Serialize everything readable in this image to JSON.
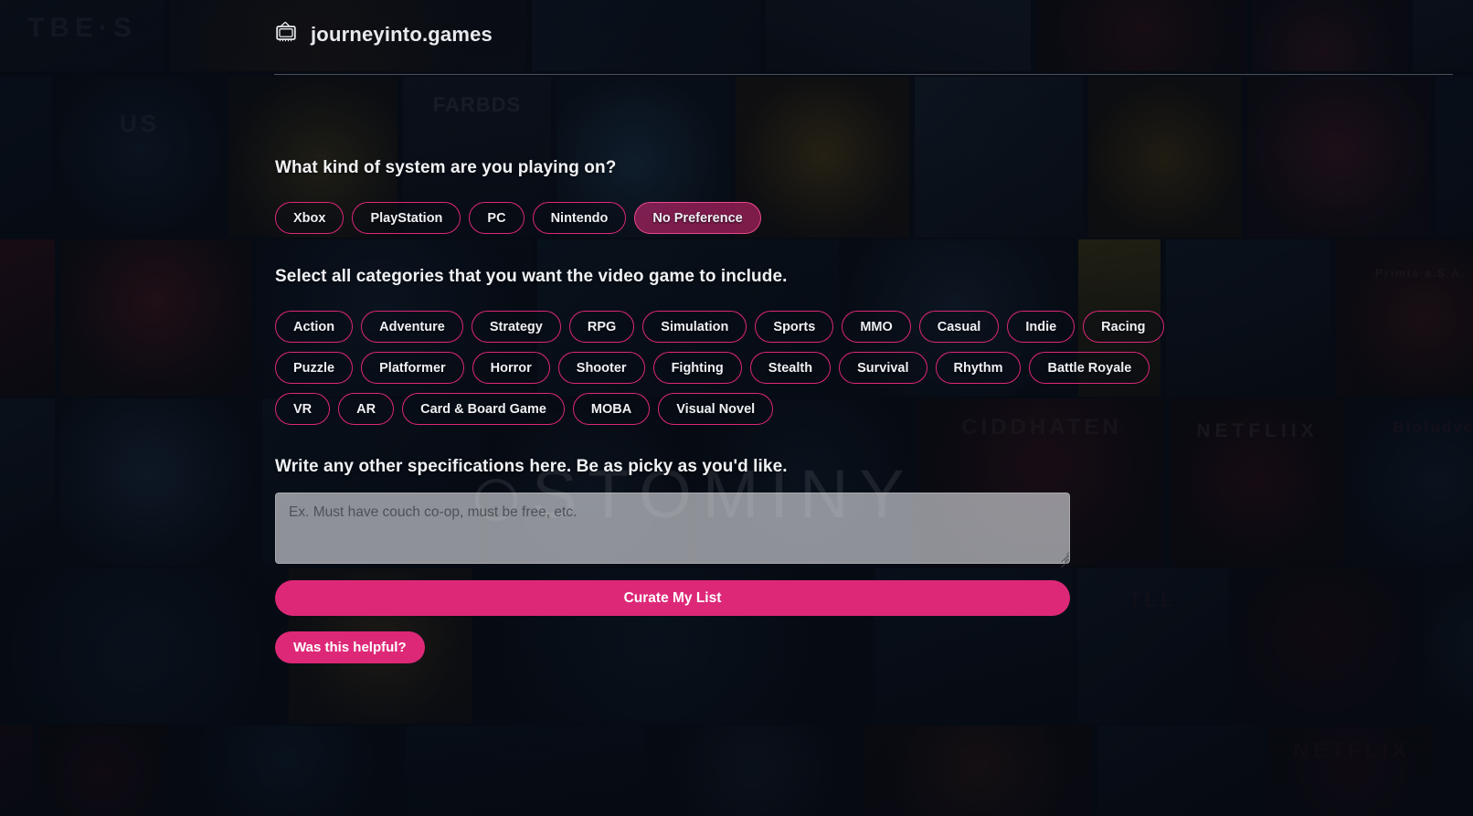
{
  "brand": {
    "name": "journeyinto.games",
    "icon": "tv-icon"
  },
  "watermark": {
    "text": "STOMINY"
  },
  "system_question": {
    "label": "What kind of system are you playing on?",
    "options": [
      {
        "label": "Xbox",
        "selected": false
      },
      {
        "label": "PlayStation",
        "selected": false
      },
      {
        "label": "PC",
        "selected": false
      },
      {
        "label": "Nintendo",
        "selected": false
      },
      {
        "label": "No Preference",
        "selected": true
      }
    ]
  },
  "category_question": {
    "label": "Select all categories that you want the video game to include.",
    "rows": [
      [
        {
          "label": "Action",
          "selected": false
        },
        {
          "label": "Adventure",
          "selected": false
        },
        {
          "label": "Strategy",
          "selected": false
        },
        {
          "label": "RPG",
          "selected": false
        },
        {
          "label": "Simulation",
          "selected": false
        },
        {
          "label": "Sports",
          "selected": false
        },
        {
          "label": "MMO",
          "selected": false
        },
        {
          "label": "Casual",
          "selected": false
        },
        {
          "label": "Indie",
          "selected": false
        },
        {
          "label": "Racing",
          "selected": false
        }
      ],
      [
        {
          "label": "Puzzle",
          "selected": false
        },
        {
          "label": "Platformer",
          "selected": false
        },
        {
          "label": "Horror",
          "selected": false
        },
        {
          "label": "Shooter",
          "selected": false
        },
        {
          "label": "Fighting",
          "selected": false
        },
        {
          "label": "Stealth",
          "selected": false
        },
        {
          "label": "Survival",
          "selected": false
        },
        {
          "label": "Rhythm",
          "selected": false
        },
        {
          "label": "Battle Royale",
          "selected": false
        }
      ],
      [
        {
          "label": "VR",
          "selected": false
        },
        {
          "label": "AR",
          "selected": false
        },
        {
          "label": "Card & Board Game",
          "selected": false
        },
        {
          "label": "MOBA",
          "selected": false
        },
        {
          "label": "Visual Novel",
          "selected": false
        }
      ]
    ]
  },
  "specs": {
    "label": "Write any other specifications here. Be as picky as you'd like.",
    "placeholder": "Ex. Must have couch co-op, must be free, etc.",
    "value": ""
  },
  "actions": {
    "submit_label": "Curate My List",
    "feedback_label": "Was this helpful?"
  },
  "colors": {
    "accent": "#dd2878",
    "accent_selected": "#e8488d",
    "page_background": "#0a0f18",
    "text_primary": "#f0f2f5"
  },
  "background": {
    "description": "dark collage of game cover art tiles",
    "visible_tile_text": [
      "NETFLIIX",
      "NETFLIX",
      "Primis a.S A."
    ]
  }
}
